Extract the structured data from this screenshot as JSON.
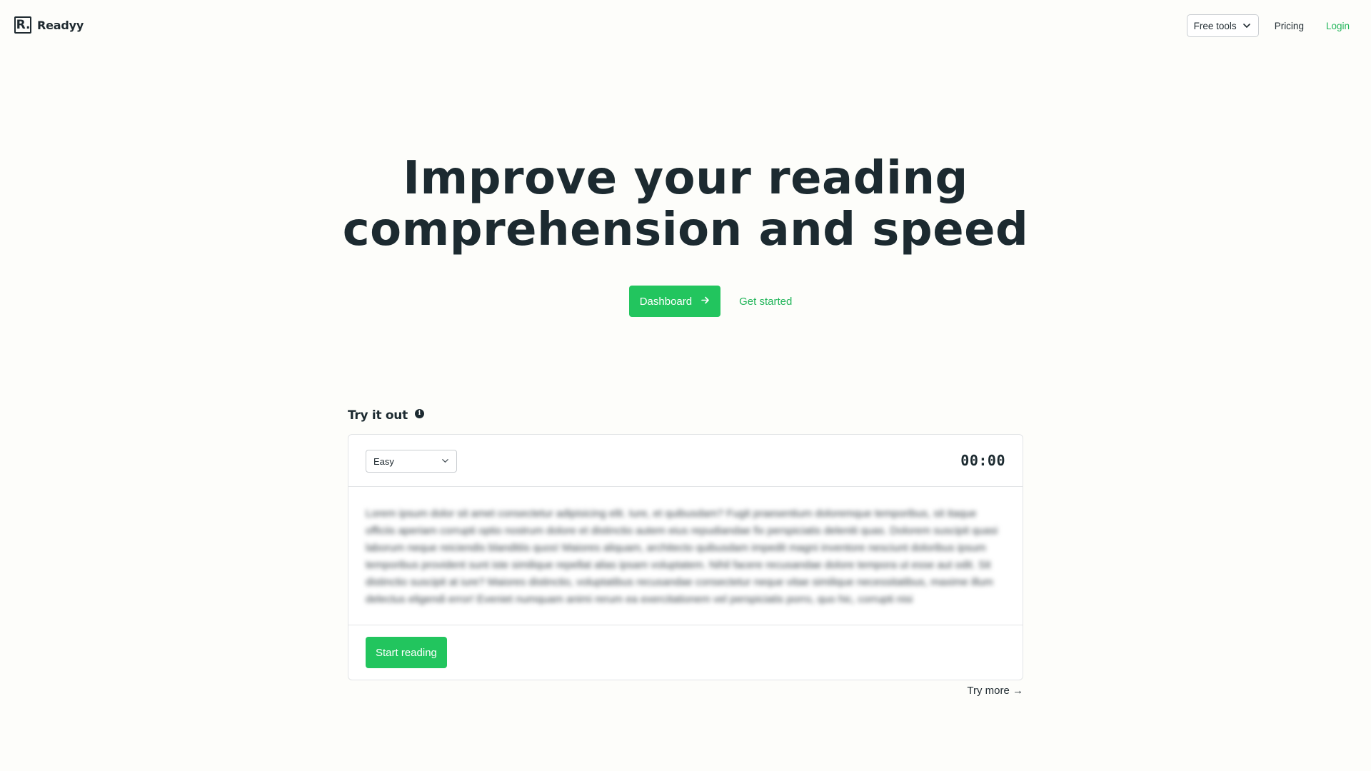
{
  "header": {
    "logo_mark": "R.",
    "logo_text": "Readyy",
    "nav": {
      "free_tools_label": "Free tools",
      "pricing_label": "Pricing",
      "login_label": "Login"
    }
  },
  "hero": {
    "title_line1": "Improve your reading",
    "title_line2": "comprehension and speed",
    "dashboard_label": "Dashboard",
    "get_started_label": "Get started"
  },
  "try_it_out": {
    "title": "Try it out",
    "info_glyph": "i",
    "difficulty_selected": "Easy",
    "timer": "00:00",
    "passage": "Lorem ipsum dolor sit amet consectetur adipisicing elit. Iure, et quibusdam? Fugit praesentium doloremque temporibus, sit itaque officiis aperiam corrupti optio nostrum dolore et distinctio autem eius repudiandae fix perspiciatis deleniti quas. Dolorem suscipit quasi laborum neque reiciendis blanditiis quos! Maiores aliquam, architecto quibusdam impedit magni inventore nesciunt doloribus ipsum temporibus provident sunt iste similique repellat alias ipsam voluptatem. Nihil facere recusandae dolore tempora ut esse aut odit. Sit distinctio suscipit at iure? Maiores distinctio, voluptatibus recusandae consectetur neque vitae similique necessitatibus, maxime illum delectus eligendi error! Eveniet numquam animi rerum ea exercitationem vel perspiciatis porro, quo hic, corrupti nisi",
    "start_label": "Start reading",
    "try_more_label": "Try more →"
  },
  "colors": {
    "accent": "#22c55e",
    "text": "#1c2a30",
    "background": "#fdfdfa"
  },
  "icons": [
    "chevron-down-icon",
    "arrow-right-icon",
    "info-icon"
  ]
}
